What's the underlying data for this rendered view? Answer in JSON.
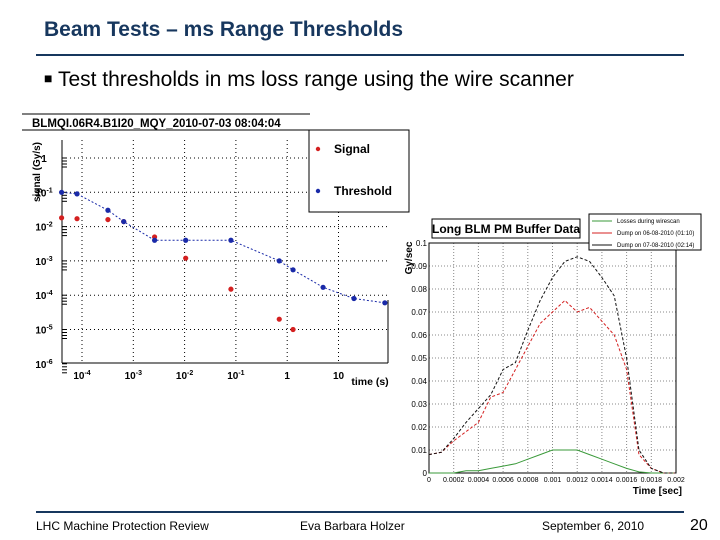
{
  "slide": {
    "title": "Beam Tests – ms Range Thresholds",
    "bullet_icon": "square-bullet",
    "bullet": "Test thresholds in ms loss range using the wire scanner"
  },
  "footer": {
    "left": "LHC Machine Protection Review",
    "center": "Eva Barbara Holzer",
    "date": "September 6, 2010",
    "page": "20"
  },
  "chart_data": [
    {
      "type": "scatter",
      "title": "BLMQI.06R4.B1I20_MQY_2010-07-03 08:04:04",
      "xlabel": "time (s)",
      "ylabel": "signal (Gy/s)",
      "xscale": "log",
      "yscale": "log",
      "xlim": [
        4e-05,
        100
      ],
      "ylim": [
        1e-06,
        2
      ],
      "xticks": [
        "10^-4",
        "10^-3",
        "10^-2",
        "10^-1",
        "1",
        "10"
      ],
      "yticks": [
        "1",
        "10^-1",
        "10^-2",
        "10^-3",
        "10^-4",
        "10^-5",
        "10^-6"
      ],
      "grid": true,
      "legend": "top-right",
      "series": [
        {
          "name": "Signal",
          "color": "#d42020",
          "x": [
            4e-05,
            8e-05,
            0.00032,
            0.00065,
            0.0026,
            0.0105,
            0.08,
            0.7,
            1.3
          ],
          "y": [
            0.018,
            0.017,
            0.016,
            0.014,
            0.005,
            0.0012,
            0.00015,
            2e-05,
            1e-05
          ]
        },
        {
          "name": "Threshold",
          "color": "#1a2aa8",
          "x": [
            4e-05,
            8e-05,
            0.00032,
            0.00065,
            0.0026,
            0.0105,
            0.08,
            0.7,
            1.3,
            5,
            20,
            80
          ],
          "y": [
            0.1,
            0.09,
            0.03,
            0.014,
            0.004,
            0.004,
            0.004,
            0.001,
            0.00055,
            0.00017,
            8e-05,
            6e-05
          ]
        }
      ]
    },
    {
      "type": "line",
      "title": "Long BLM PM Buffer Data",
      "xlabel": "Time [sec]",
      "ylabel": "Gy/sec",
      "xlim": [
        0,
        0.002
      ],
      "ylim": [
        0,
        0.1
      ],
      "xticks": [
        "0",
        "0.0002",
        "0.0004",
        "0.0006",
        "0.0008",
        "0.001",
        "0.0012",
        "0.0014",
        "0.0016",
        "0.0018",
        "0.002"
      ],
      "yticks": [
        "0",
        "0.01",
        "0.02",
        "0.03",
        "0.04",
        "0.05",
        "0.06",
        "0.07",
        "0.08",
        "0.09",
        "0.1"
      ],
      "grid": true,
      "legend": "top-right",
      "x": [
        0,
        0.0001,
        0.0002,
        0.0003,
        0.0004,
        0.0005,
        0.0006,
        0.0007,
        0.0008,
        0.0009,
        0.001,
        0.0011,
        0.0012,
        0.0013,
        0.0014,
        0.0015,
        0.0016,
        0.0017,
        0.0018,
        0.0019,
        0.002
      ],
      "series": [
        {
          "name": "Losses during wirescan",
          "color": "#3a9a3a",
          "values": [
            0,
            0,
            0,
            0.001,
            0.001,
            0.002,
            0.003,
            0.004,
            0.006,
            0.008,
            0.01,
            0.01,
            0.01,
            0.008,
            0.006,
            0.004,
            0.002,
            0.0005,
            0,
            0,
            0
          ]
        },
        {
          "name": "Dump on 06-08-2010 (01:10)",
          "color": "#d42020",
          "values": [
            0.008,
            0.009,
            0.014,
            0.018,
            0.022,
            0.033,
            0.035,
            0.045,
            0.055,
            0.065,
            0.07,
            0.075,
            0.07,
            0.072,
            0.066,
            0.06,
            0.045,
            0.008,
            0.002,
            0,
            0
          ]
        },
        {
          "name": "Dump on 07-08-2010 (02:14)",
          "color": "#111111",
          "values": [
            0.008,
            0.009,
            0.015,
            0.022,
            0.028,
            0.034,
            0.045,
            0.048,
            0.062,
            0.075,
            0.085,
            0.092,
            0.094,
            0.092,
            0.085,
            0.077,
            0.05,
            0.01,
            0.002,
            0,
            0
          ]
        }
      ]
    }
  ]
}
